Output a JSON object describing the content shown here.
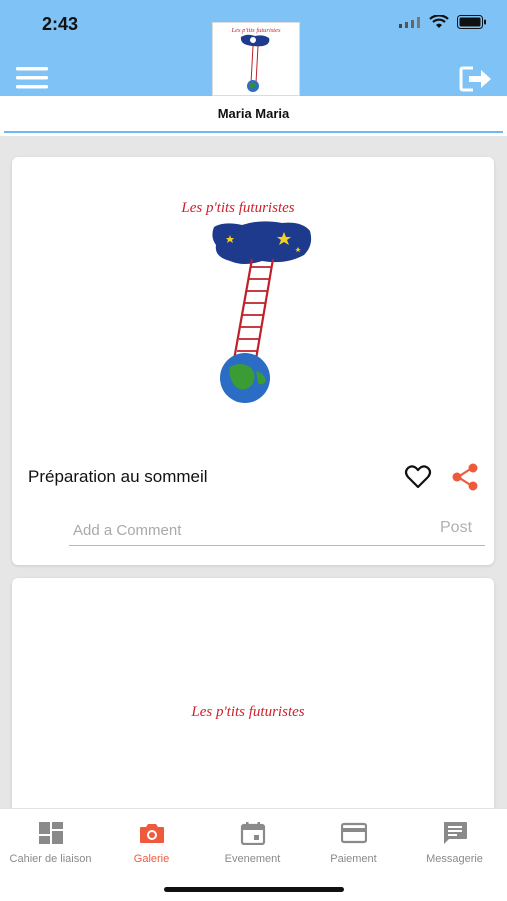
{
  "status": {
    "time": "2:43"
  },
  "header": {
    "logo_text": "Les p'tits futuristes"
  },
  "user": {
    "name": "Maria Maria"
  },
  "posts": [
    {
      "logo_text": "Les p'tits futuristes",
      "title": "Préparation au sommeil",
      "comment_placeholder": "Add a Comment",
      "post_label": "Post"
    },
    {
      "logo_text": "Les p'tits futuristes"
    }
  ],
  "tabs": [
    {
      "label": "Cahier de liaison",
      "icon": "dashboard-icon"
    },
    {
      "label": "Galerie",
      "icon": "camera-icon",
      "active": true
    },
    {
      "label": "Evenement",
      "icon": "calendar-icon"
    },
    {
      "label": "Paiement",
      "icon": "credit-card-icon"
    },
    {
      "label": "Messagerie",
      "icon": "message-icon"
    }
  ],
  "colors": {
    "header": "#7fc2f6",
    "accent": "#f05a3c",
    "logo_red": "#d0202a",
    "inactive": "#8a8a8a"
  }
}
